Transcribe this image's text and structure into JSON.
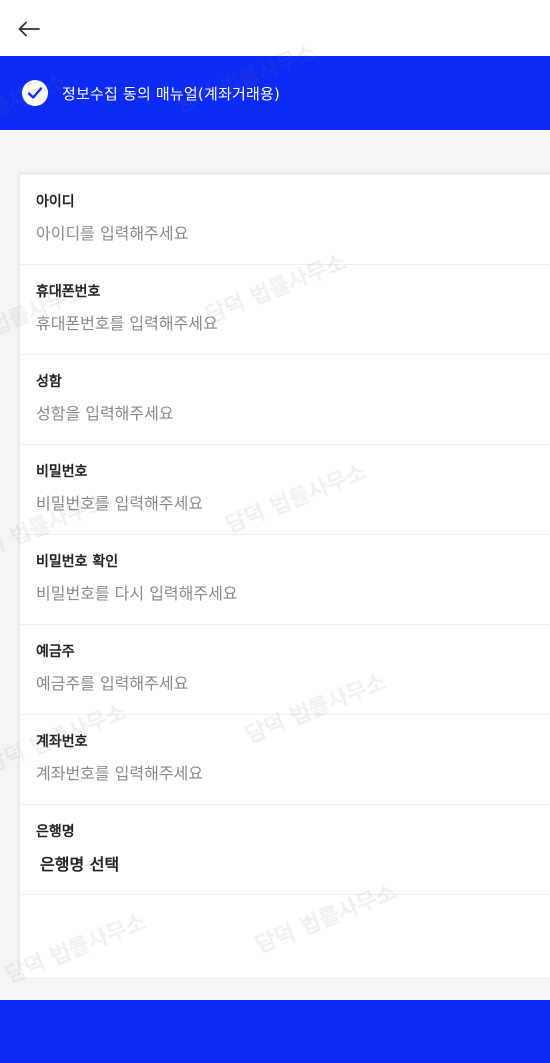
{
  "header": {
    "back_icon": "arrow-left-icon"
  },
  "consent": {
    "label": "정보수집 동의 매뉴얼(계좌거래용)",
    "check_icon": "check-icon",
    "accent_color": "#0d2bf5"
  },
  "form": {
    "fields": [
      {
        "label": "아이디",
        "placeholder": "아이디를 입력해주세요"
      },
      {
        "label": "휴대폰번호",
        "placeholder": "휴대폰번호를 입력해주세요"
      },
      {
        "label": "성함",
        "placeholder": "성함을 입력해주세요"
      },
      {
        "label": "비밀번호",
        "placeholder": "비밀번호를 입력해주세요"
      },
      {
        "label": "비밀번호 확인",
        "placeholder": "비밀번호를 다시 입력해주세요"
      },
      {
        "label": "예금주",
        "placeholder": "예금주를 입력해주세요"
      },
      {
        "label": "계좌번호",
        "placeholder": "계좌번호를 입력해주세요"
      }
    ],
    "bank": {
      "label": "은행명",
      "value": "은행명 선택"
    }
  },
  "watermark": {
    "text": "담덕 법률사무소"
  }
}
